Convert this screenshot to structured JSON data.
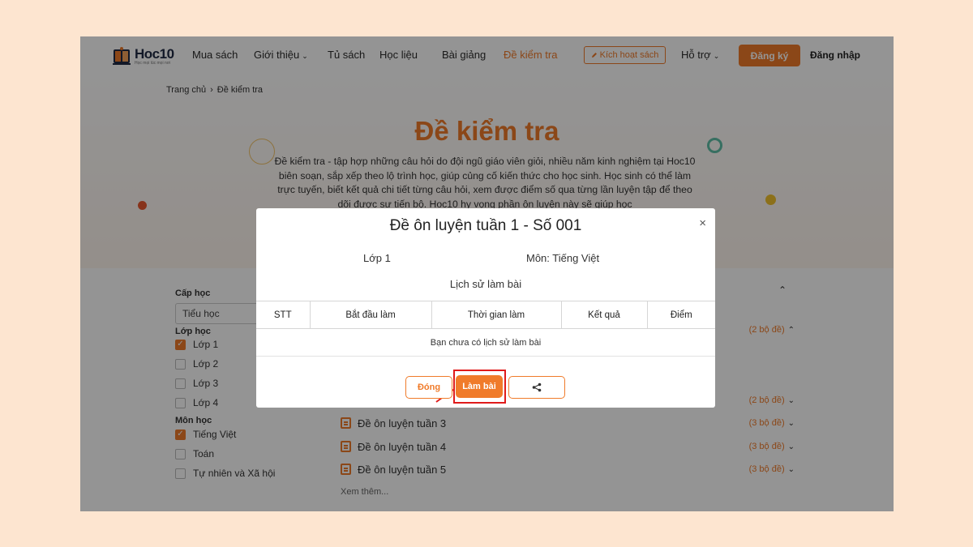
{
  "header": {
    "logo": {
      "name": "Hoc10",
      "tagline": "Học mọi lúc mọi nơi"
    },
    "nav": [
      {
        "label": "Mua sách",
        "dropdown": false,
        "active": false
      },
      {
        "label": "Giới thiệu",
        "dropdown": true,
        "active": false
      },
      {
        "label": "Tủ sách",
        "dropdown": false,
        "active": false
      },
      {
        "label": "Học liệu",
        "dropdown": false,
        "active": false
      },
      {
        "label": "Bài giảng",
        "dropdown": false,
        "active": false
      },
      {
        "label": "Đề kiểm tra",
        "dropdown": false,
        "active": true
      }
    ],
    "activate_label": "Kích hoạt sách",
    "support_label": "Hỗ trợ",
    "register_label": "Đăng ký",
    "login_label": "Đăng nhập"
  },
  "breadcrumb": {
    "home": "Trang chủ",
    "current": "Đề kiểm tra"
  },
  "hero": {
    "title": "Đề kiểm tra",
    "intro": "Đề kiểm tra - tập hợp những câu hỏi do đội ngũ giáo viên giỏi, nhiều năm kinh nghiệm tại Hoc10 biên soạn, sắp xếp theo lộ trình học, giúp củng cố kiến thức cho học sinh. Học sinh có thể làm trực tuyến, biết kết quả chi tiết từng câu hỏi, xem được điểm số qua từng lần luyện tập để theo dõi được sự tiến bộ. Hoc10 hy vọng phần ôn luyện này sẽ giúp học"
  },
  "sidebar": {
    "level_label": "Cấp học",
    "level_value": "Tiểu học",
    "grade_label": "Lớp học",
    "grades": [
      {
        "label": "Lớp 1",
        "checked": true
      },
      {
        "label": "Lớp 2",
        "checked": false
      },
      {
        "label": "Lớp 3",
        "checked": false
      },
      {
        "label": "Lớp 4",
        "checked": false
      }
    ],
    "subject_label": "Môn học",
    "subjects": [
      {
        "label": "Tiếng Việt",
        "checked": true
      },
      {
        "label": "Toán",
        "checked": false
      },
      {
        "label": "Tự nhiên và Xã hội",
        "checked": false
      }
    ]
  },
  "tests": {
    "partial_rows": [
      {
        "count": "(2 bộ đề)",
        "caret": "up"
      },
      {
        "count": "(2 bộ đề)",
        "caret": "down"
      }
    ],
    "rows": [
      {
        "name": "Đề ôn luyện tuần 3",
        "count": "(3 bộ đề)"
      },
      {
        "name": "Đề ôn luyện tuần 4",
        "count": "(3 bộ đề)"
      },
      {
        "name": "Đề ôn luyện tuần 5",
        "count": "(3 bộ đề)"
      }
    ],
    "see_more": "Xem thêm..."
  },
  "modal": {
    "title": "Đề ôn luyện tuần 1 - Số 001",
    "grade": "Lớp 1",
    "subject": "Môn: Tiếng Việt",
    "history_title": "Lịch sử làm bài",
    "columns": [
      "STT",
      "Bắt đầu làm",
      "Thời gian làm",
      "Kết quả",
      "Điểm"
    ],
    "empty_text": "Bạn chưa có lịch sử làm bài",
    "close_label": "Đóng",
    "start_label": "Làm bài"
  },
  "colors": {
    "accent": "#f07b2a",
    "highlight": "#e01b1b"
  }
}
